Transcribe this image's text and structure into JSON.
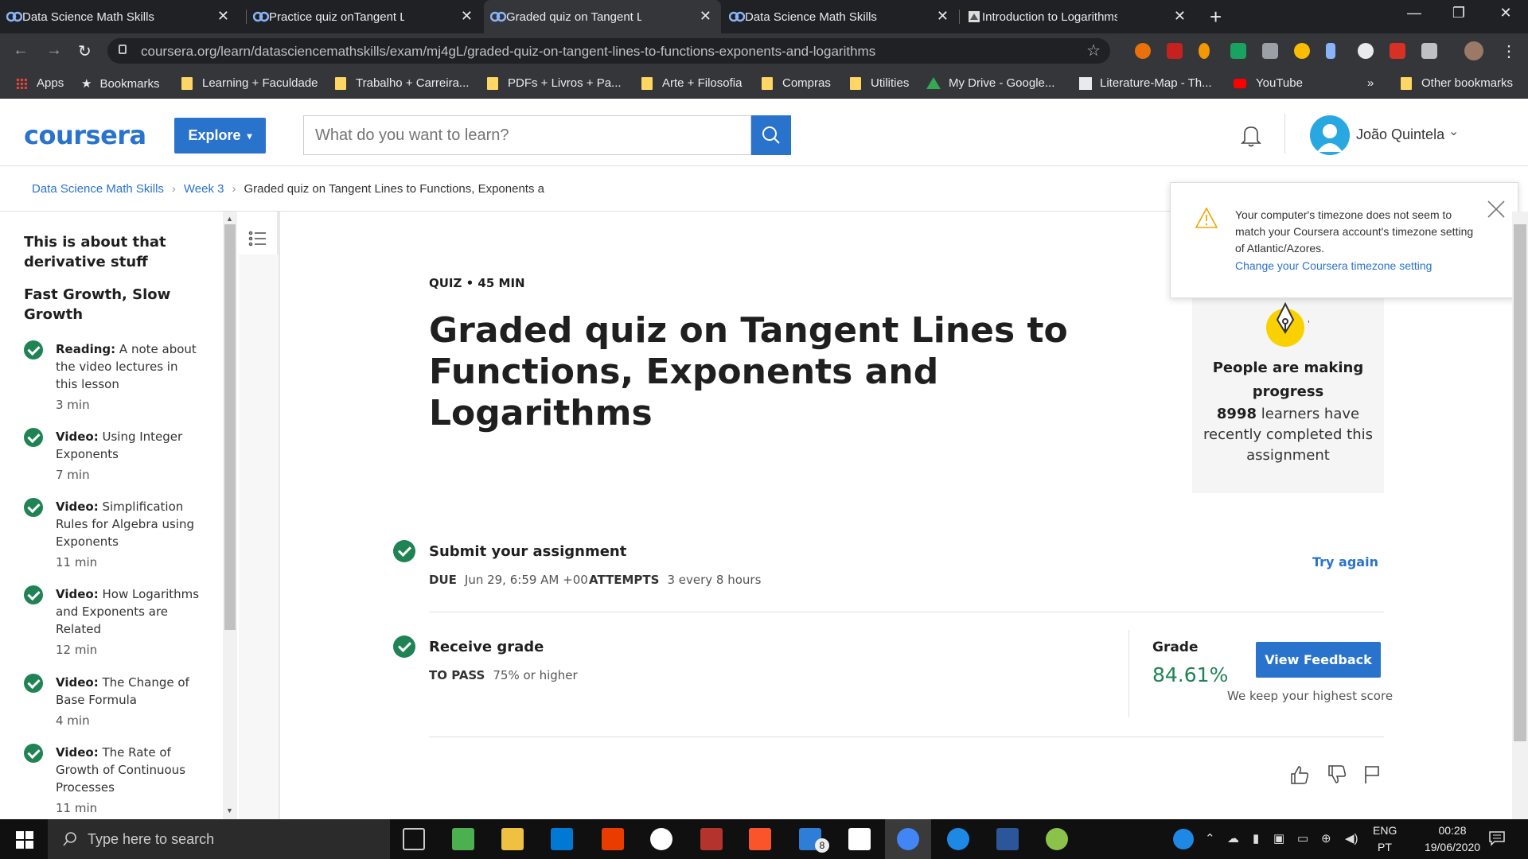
{
  "browser": {
    "tabs": [
      {
        "label": "Data Science Math Skills - Buildin"
      },
      {
        "label": "Practice quiz onTangent Lines to"
      },
      {
        "label": "Graded quiz on Tangent Lines to"
      },
      {
        "label": "Data Science Math Skills - Home"
      },
      {
        "label": "Introduction to Logarithms"
      }
    ],
    "url": "coursera.org/learn/datasciencemathskills/exam/mj4gL/graded-quiz-on-tangent-lines-to-functions-exponents-and-logarithms",
    "bookmarks": [
      {
        "label": "Apps"
      },
      {
        "label": "Bookmarks"
      },
      {
        "label": "Learning + Faculdade"
      },
      {
        "label": "Trabalho + Carreira..."
      },
      {
        "label": "PDFs + Livros + Pa..."
      },
      {
        "label": "Arte + Filosofia"
      },
      {
        "label": "Compras"
      },
      {
        "label": "Utilities"
      },
      {
        "label": "My Drive - Google..."
      },
      {
        "label": "Literature-Map - Th..."
      },
      {
        "label": "YouTube"
      },
      {
        "label": "»"
      },
      {
        "label": "Other bookmarks"
      }
    ]
  },
  "header": {
    "logo": "coursera",
    "explore_label": "Explore",
    "search_placeholder": "What do you want to learn?",
    "user_name": "João Quintela"
  },
  "breadcrumb": {
    "items": [
      "Data Science Math Skills",
      "Week 3",
      "Graded quiz on Tangent Lines to Functions, Exponents a"
    ]
  },
  "sidebar": {
    "heading1": "This is about that derivative stuff",
    "heading2": "Fast Growth, Slow Growth",
    "items": [
      {
        "type": "Reading:",
        "title": "A note about the video lectures in this lesson",
        "duration": "3 min"
      },
      {
        "type": "Video:",
        "title": "Using Integer Exponents",
        "duration": "7 min"
      },
      {
        "type": "Video:",
        "title": "Simplification Rules for Algebra using Exponents",
        "duration": "11 min"
      },
      {
        "type": "Video:",
        "title": "How Logarithms and Exponents are Related",
        "duration": "12 min"
      },
      {
        "type": "Video:",
        "title": "The Change of Base Formula",
        "duration": "4 min"
      },
      {
        "type": "Video:",
        "title": "The Rate of Growth of Continuous Processes",
        "duration": "11 min"
      }
    ]
  },
  "main": {
    "meta": "QUIZ • 45 MIN",
    "title": "Graded quiz on Tangent Lines to Functions, Exponents and Logarithms",
    "submit": {
      "title": "Submit your assignment",
      "due_label": "DUE",
      "due_value": "Jun 29, 6:59 AM +00",
      "attempts_label": "ATTEMPTS",
      "attempts_value": "3 every 8 hours",
      "action": "Try again"
    },
    "receive": {
      "title": "Receive grade",
      "pass_label": "TO PASS",
      "pass_value": "75% or higher",
      "grade_label": "Grade",
      "grade_value": "84.61%",
      "feedback_label": "View Feedback",
      "keep_note": "We keep your highest score"
    }
  },
  "progress_card": {
    "heading": "People are making progress",
    "count": "8998",
    "text": "learners have recently completed this assignment"
  },
  "toast": {
    "message": "Your computer's timezone does not seem to match your Coursera account's timezone setting of Atlantic/Azores.",
    "link": "Change your Coursera timezone setting"
  },
  "taskbar": {
    "search_placeholder": "Type here to search",
    "badge_count": "8",
    "lang_top": "ENG",
    "lang_bottom": "PT",
    "time": "00:28",
    "date": "19/06/2020"
  },
  "colors": {
    "brand_blue": "#2a73cc",
    "success_green": "#1f8354",
    "chrome_dark": "#202124",
    "chrome_toolbar": "#35363a"
  }
}
